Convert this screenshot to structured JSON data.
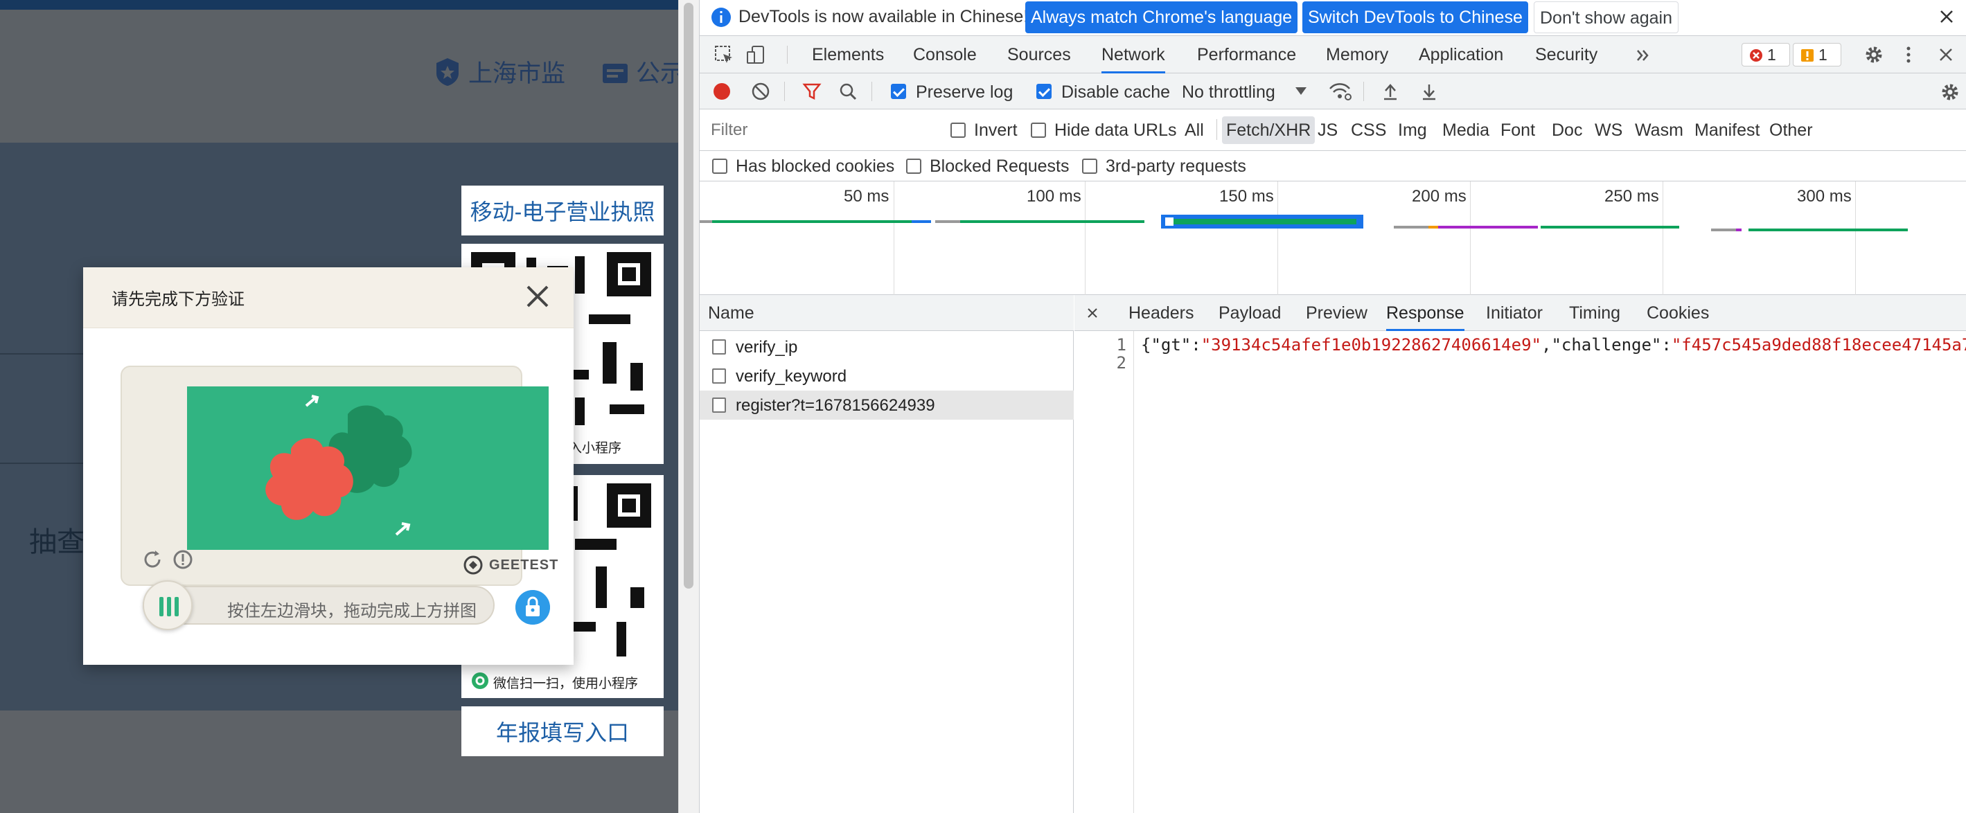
{
  "page": {
    "nav": [
      {
        "label": "上海市监",
        "icon": "badge-icon"
      },
      {
        "label": "公示",
        "icon": "document-icon"
      }
    ],
    "sidebar": {
      "mobile_license_title": "移动-电子营业执照",
      "qr1_caption": "扫一扫，进入小程序",
      "qr2_caption": "微信扫一扫，使用小程序",
      "annual_report_link": "年报填写入口"
    },
    "check_text": "抽查"
  },
  "captcha_dialog": {
    "title": "请先完成下方验证",
    "close_icon": "close-icon",
    "refresh_icon": "refresh-icon",
    "info_icon": "info-icon",
    "brand": "GEETEST",
    "slider_hint": "按住左边滑块，拖动完成上方拼图",
    "lock_icon": "lock-icon"
  },
  "devtools": {
    "infobar": {
      "message": "DevTools is now available in Chinese!",
      "btn_match": "Always match Chrome's language",
      "btn_switch": "Switch DevTools to Chinese",
      "btn_dismiss": "Don't show again"
    },
    "tabs": [
      "Elements",
      "Console",
      "Sources",
      "Network",
      "Performance",
      "Memory",
      "Application",
      "Security"
    ],
    "active_tab": "Network",
    "error_count": "1",
    "warning_count": "1",
    "toolbar": {
      "preserve_log": "Preserve log",
      "disable_cache": "Disable cache",
      "throttling": "No throttling"
    },
    "filter": {
      "placeholder": "Filter",
      "invert": "Invert",
      "hide_data_urls": "Hide data URLs",
      "types": [
        "All",
        "Fetch/XHR",
        "JS",
        "CSS",
        "Img",
        "Media",
        "Font",
        "Doc",
        "WS",
        "Wasm",
        "Manifest",
        "Other"
      ],
      "selected_type": "Fetch/XHR",
      "has_blocked_cookies": "Has blocked cookies",
      "blocked_requests": "Blocked Requests",
      "third_party": "3rd-party requests"
    },
    "timeline_ticks": [
      "50 ms",
      "100 ms",
      "150 ms",
      "200 ms",
      "250 ms",
      "300 ms"
    ],
    "name_header": "Name",
    "requests": [
      "verify_ip",
      "verify_keyword",
      "register?t=1678156624939"
    ],
    "selected_request": "register?t=1678156624939",
    "detail_tabs": [
      "Headers",
      "Payload",
      "Preview",
      "Response",
      "Initiator",
      "Timing",
      "Cookies"
    ],
    "active_detail_tab": "Response",
    "response": {
      "line1_num": "1",
      "line2_num": "2",
      "key_gt": "\"gt\"",
      "val_gt": "\"39134c54afef1e0b19228627406614e9\"",
      "key_challenge": "\"challenge\"",
      "val_challenge": "\"f457c545a9ded88f18ecee47145a7"
    },
    "colors": {
      "accent": "#1a73e8",
      "record": "#d93025",
      "string": "#c41a16"
    }
  }
}
